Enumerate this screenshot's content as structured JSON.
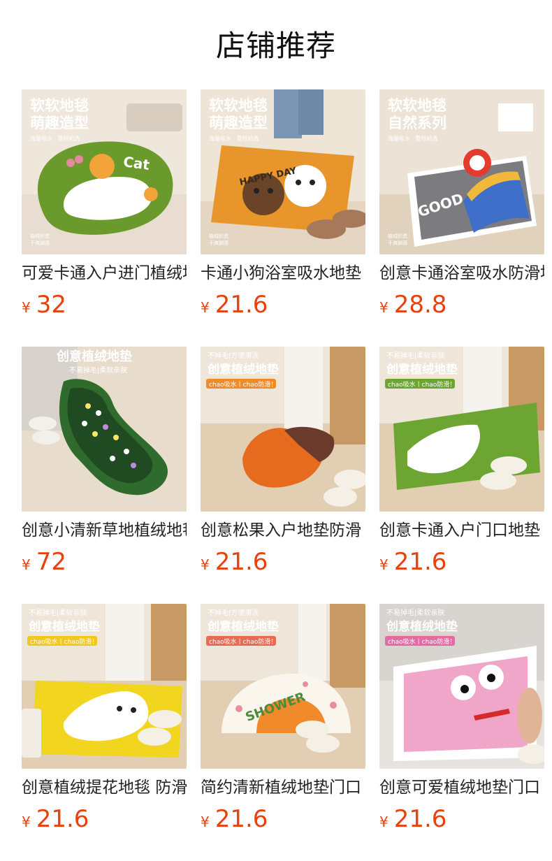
{
  "shop": {
    "title": "店铺推荐"
  },
  "products": [
    {
      "name": "可爱卡通入户进门植绒地毯",
      "currency": "¥",
      "price": "32",
      "overlay": {
        "line1": "软软地毯",
        "line2": "萌趣造型",
        "features": "海量吸水 · 整毯机洗",
        "note1": "植绒织造",
        "note2": "干爽脚感",
        "rug_text": "Cat"
      }
    },
    {
      "name": "卡通小狗浴室吸水地垫",
      "currency": "¥",
      "price": "21.6",
      "overlay": {
        "line1": "软软地毯",
        "line2": "萌趣造型",
        "features": "海量吸水 · 整毯机洗",
        "note1": "植绒织造",
        "note2": "干爽脚感",
        "rug_text": "HAPPY DAY"
      }
    },
    {
      "name": "创意卡通浴室吸水防滑地垫",
      "currency": "¥",
      "price": "28.8",
      "overlay": {
        "line1": "软软地毯",
        "line2": "自然系列",
        "features": "海量吸水 · 整毯机洗",
        "note1": "植绒织造",
        "note2": "干爽脚感",
        "rug_text": "GOOD"
      }
    },
    {
      "name": "创意小清新草地植绒地毯",
      "currency": "¥",
      "price": "72",
      "overlay": {
        "line1": "创意植绒地垫",
        "line2": "不易掉毛|柔软亲肤"
      }
    },
    {
      "name": "创意松果入户地垫防滑",
      "currency": "¥",
      "price": "21.6",
      "overlay": {
        "line0": "不掉毛|方便清洗",
        "line1": "创意植绒地垫",
        "tag": "chao吸水丨chao防滑！"
      }
    },
    {
      "name": "创意卡通入户门口地垫",
      "currency": "¥",
      "price": "21.6",
      "overlay": {
        "line0": "不易掉毛|柔软亲肤",
        "line1": "创意植绒地垫",
        "tag": "chao吸水丨chao防滑！"
      }
    },
    {
      "name": "创意植绒提花地毯 防滑",
      "currency": "¥",
      "price": "21.6",
      "overlay": {
        "line0": "不易掉毛|柔软亲肤",
        "line1": "创意植绒地垫",
        "tag": "chao吸水丨chao防滑！"
      }
    },
    {
      "name": "简约清新植绒地垫门口",
      "currency": "¥",
      "price": "21.6",
      "overlay": {
        "line0": "不掉毛|方便清洗",
        "line1": "创意植绒地垫",
        "tag": "chao吸水丨chao防滑！",
        "rug_text": "SHOWER"
      }
    },
    {
      "name": "创意可爱植绒地垫门口",
      "currency": "¥",
      "price": "21.6",
      "overlay": {
        "line0": "不易掉毛|柔软亲肤",
        "line1": "创意植绒地垫",
        "tag": "chao吸水丨chao防滑！"
      }
    }
  ]
}
